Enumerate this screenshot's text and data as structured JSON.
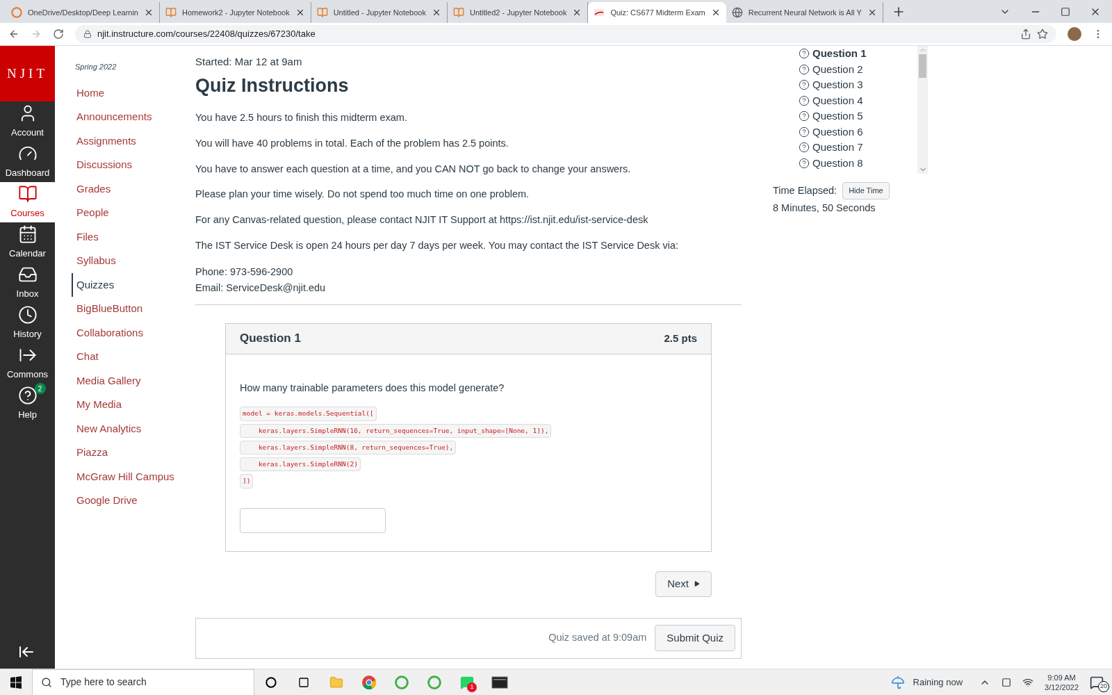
{
  "browser": {
    "tabs": [
      {
        "title": "OneDrive/Desktop/Deep Learnin",
        "kind": "onedrive",
        "selected": false
      },
      {
        "title": "Homework2 - Jupyter Notebook",
        "kind": "jupyter",
        "selected": false
      },
      {
        "title": "Untitled - Jupyter Notebook",
        "kind": "jupyter",
        "selected": false
      },
      {
        "title": "Untitled2 - Jupyter Notebook",
        "kind": "jupyter",
        "selected": false
      },
      {
        "title": "Quiz: CS677 Midterm Exam",
        "kind": "njit",
        "selected": true
      },
      {
        "title": "Recurrent Neural Network is All Y",
        "kind": "globe",
        "selected": false
      }
    ],
    "url": "njit.instructure.com/courses/22408/quizzes/67230/take"
  },
  "global_nav": {
    "logo": "NJIT",
    "items": [
      {
        "label": "Account",
        "kind": "account",
        "selected": false
      },
      {
        "label": "Dashboard",
        "kind": "dashboard",
        "selected": false
      },
      {
        "label": "Courses",
        "kind": "courses",
        "selected": true
      },
      {
        "label": "Calendar",
        "kind": "calendar",
        "selected": false
      },
      {
        "label": "Inbox",
        "kind": "inbox",
        "selected": false
      },
      {
        "label": "History",
        "kind": "history",
        "selected": false
      },
      {
        "label": "Commons",
        "kind": "commons",
        "selected": false
      },
      {
        "label": "Help",
        "kind": "help",
        "selected": false,
        "badge": "2"
      }
    ]
  },
  "course_nav": {
    "term": "Spring 2022",
    "items": [
      {
        "label": "Home",
        "selected": false
      },
      {
        "label": "Announcements",
        "selected": false
      },
      {
        "label": "Assignments",
        "selected": false
      },
      {
        "label": "Discussions",
        "selected": false
      },
      {
        "label": "Grades",
        "selected": false
      },
      {
        "label": "People",
        "selected": false
      },
      {
        "label": "Files",
        "selected": false
      },
      {
        "label": "Syllabus",
        "selected": false
      },
      {
        "label": "Quizzes",
        "selected": true
      },
      {
        "label": "BigBlueButton",
        "selected": false
      },
      {
        "label": "Collaborations",
        "selected": false
      },
      {
        "label": "Chat",
        "selected": false
      },
      {
        "label": "Media Gallery",
        "selected": false
      },
      {
        "label": "My Media",
        "selected": false
      },
      {
        "label": "New Analytics",
        "selected": false
      },
      {
        "label": "Piazza",
        "selected": false
      },
      {
        "label": "McGraw Hill Campus",
        "selected": false
      },
      {
        "label": "Google Drive",
        "selected": false
      }
    ]
  },
  "quiz": {
    "started": "Started: Mar 12 at 9am",
    "title": "Quiz Instructions",
    "paragraphs": [
      "You have 2.5 hours to finish this midterm exam.",
      "You will have 40 problems in total. Each of the problem has 2.5 points.",
      "You have to answer each question at a time, and you CAN NOT go back to change your answers.",
      "Please plan your time wisely. Do not spend too much time on one problem.",
      "For any Canvas-related question, please contact NJIT IT Support at https://ist.njit.edu/ist-service-desk",
      "The IST Service Desk is open 24 hours per day 7 days per week. You may contact the IST Service Desk via:"
    ],
    "contact": [
      "Phone: 973-596-2900",
      "Email: ServiceDesk@njit.edu"
    ],
    "question": {
      "title": "Question 1",
      "points": "2.5 pts",
      "prompt": "How many trainable parameters does this model generate?",
      "code_lines": [
        "model = keras.models.Sequential([",
        "    keras.layers.SimpleRNN(16, return_sequences=True, input_shape=[None, 1]),",
        "    keras.layers.SimpleRNN(8, return_sequences=True),",
        "    keras.layers.SimpleRNN(2)",
        "])"
      ]
    },
    "next_button": "Next",
    "saved": "Quiz saved at 9:09am",
    "submit_button": "Submit Quiz"
  },
  "question_list": [
    {
      "label": "Question 1",
      "selected": true
    },
    {
      "label": "Question 2",
      "selected": false
    },
    {
      "label": "Question 3",
      "selected": false
    },
    {
      "label": "Question 4",
      "selected": false
    },
    {
      "label": "Question 5",
      "selected": false
    },
    {
      "label": "Question 6",
      "selected": false
    },
    {
      "label": "Question 7",
      "selected": false
    },
    {
      "label": "Question 8",
      "selected": false
    }
  ],
  "timer": {
    "label": "Time Elapsed:",
    "button": "Hide Time",
    "value": "8 Minutes, 50 Seconds"
  },
  "taskbar": {
    "search_placeholder": "Type here to search",
    "apps": [
      {
        "kind": "cortana"
      },
      {
        "kind": "taskview"
      },
      {
        "kind": "explorer"
      },
      {
        "kind": "chrome"
      },
      {
        "kind": "ring"
      },
      {
        "kind": "ring"
      },
      {
        "kind": "whatsapp",
        "badge": "1"
      },
      {
        "kind": "terminal"
      }
    ],
    "weather": "Raining now",
    "time": "9:09 AM",
    "date": "3/12/2022",
    "notifications": "20"
  }
}
